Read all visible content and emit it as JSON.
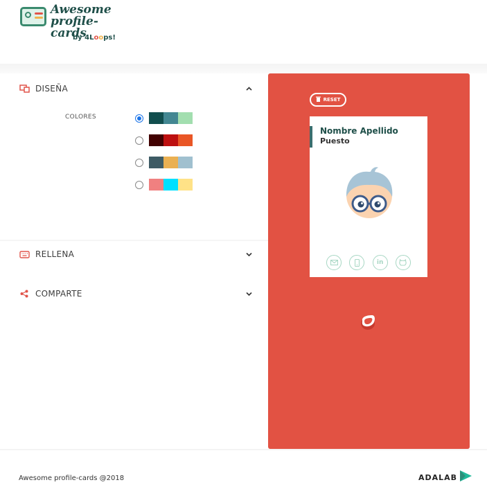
{
  "header": {
    "logo_title_1": "Awesome",
    "logo_title_2": "profile-cards",
    "logo_by": "by 4L",
    "logo_by_end": "ps!"
  },
  "sections": {
    "design": {
      "title": "DISEÑA",
      "icon": "design-icon",
      "expanded": true
    },
    "fill": {
      "title": "RELLENA",
      "icon": "keyboard-icon",
      "expanded": false
    },
    "share": {
      "title": "COMPARTE",
      "icon": "share-icon",
      "expanded": false
    }
  },
  "colors": {
    "label": "COLORES",
    "palettes": [
      {
        "selected": true,
        "swatches": [
          "#114e4e",
          "#438792",
          "#a2deaf"
        ]
      },
      {
        "selected": false,
        "swatches": [
          "#420101",
          "#bd1010",
          "#e95626"
        ]
      },
      {
        "selected": false,
        "swatches": [
          "#3e5b65",
          "#eab052",
          "#a0c0cf"
        ]
      },
      {
        "selected": false,
        "swatches": [
          "#f08080",
          "#00e0ff",
          "#ffe287"
        ]
      }
    ]
  },
  "preview": {
    "reset_label": "RESET",
    "background": "#e25243",
    "card": {
      "name": "Nombre Apellido",
      "job": "Puesto",
      "socials": [
        "email-icon",
        "phone-icon",
        "linkedin-icon",
        "github-icon"
      ],
      "linkedin_text": "in"
    }
  },
  "footer": {
    "copyright": "Awesome profile-cards @2018",
    "brand": "ADALAB"
  }
}
